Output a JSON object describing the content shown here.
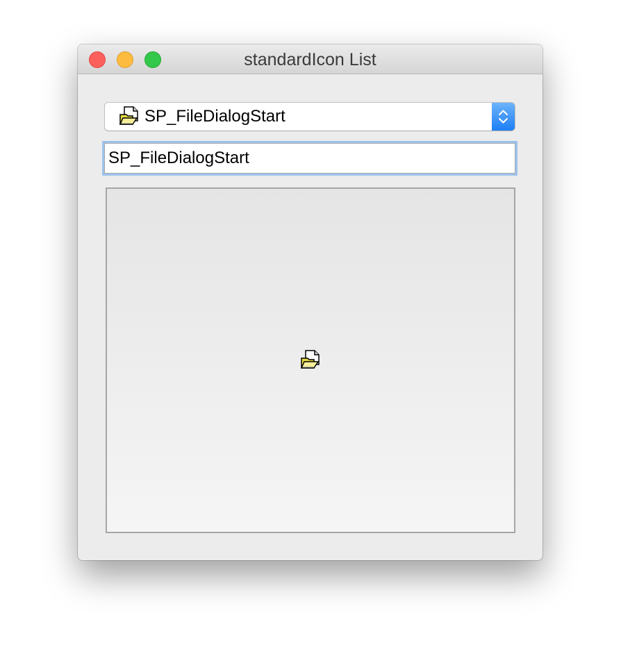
{
  "window": {
    "title": "standardIcon List"
  },
  "combo": {
    "selected_label": "SP_FileDialogStart",
    "selected_icon": "file-dialog-start-icon"
  },
  "name_field": {
    "value": "SP_FileDialogStart"
  },
  "preview": {
    "icon": "file-dialog-start-icon"
  },
  "colors": {
    "close": "#fc605c",
    "minimize": "#fdbc40",
    "zoom": "#34c84a",
    "accent": "#1d7ff5",
    "focus_ring": "#9cc3ec"
  }
}
